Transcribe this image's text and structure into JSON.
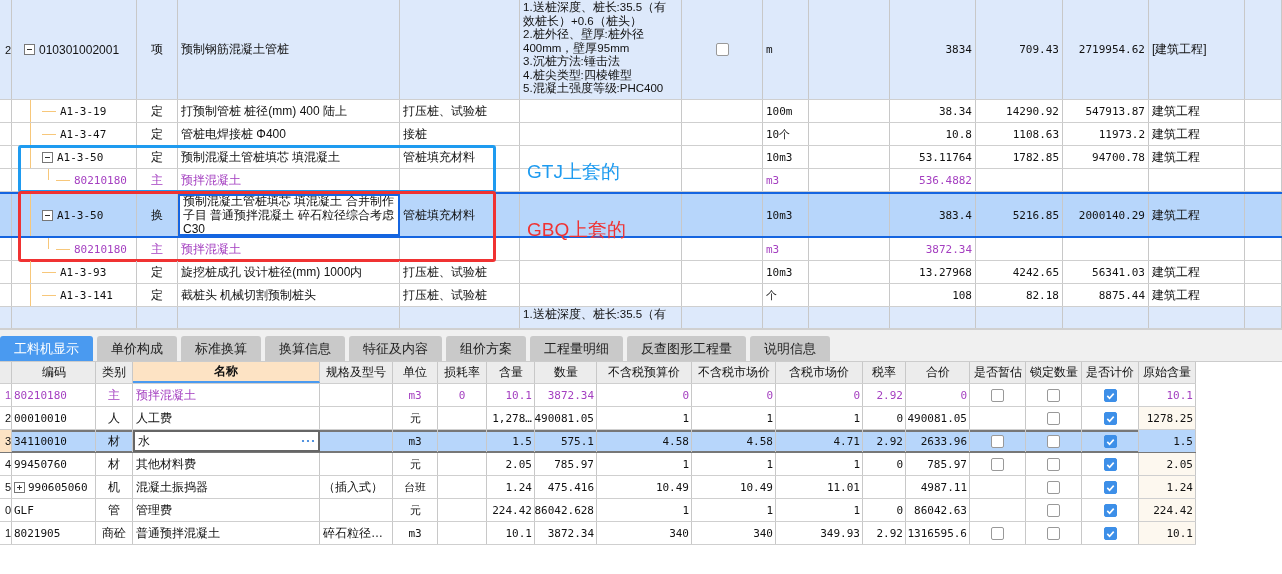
{
  "top_table": {
    "items": [
      {
        "row_no": "2",
        "code": "010301002001",
        "type": "项",
        "name": "预制钢筋混凝土管桩",
        "description": "1.送桩深度、桩长:35.5（有效桩长）+0.6（桩头）\n2.桩外径、壁厚:桩外径400mm，壁厚95mm\n3.沉桩方法:锤击法\n4.桩尖类型:四棱锥型\n5.混凝土强度等级:PHC400",
        "checked": false,
        "unit": "m",
        "quantity": "3834",
        "price": "709.43",
        "total": "2719954.62",
        "specialty": "[建筑工程]",
        "expanded": true,
        "children": [
          {
            "code": "A1-3-19",
            "type": "定",
            "name": "打预制管桩 桩径(mm) 400 陆上",
            "feature": "打压桩、试验桩",
            "unit": "100m",
            "quantity": "38.34",
            "price": "14290.92",
            "total": "547913.87",
            "specialty": "建筑工程",
            "selected": false
          },
          {
            "code": "A1-3-47",
            "type": "定",
            "name": "管桩电焊接桩 Φ400",
            "feature": "接桩",
            "unit": "10个",
            "quantity": "10.8",
            "price": "1108.63",
            "total": "11973.2",
            "specialty": "建筑工程",
            "selected": false
          },
          {
            "code": "A1-3-50",
            "type": "定",
            "name": "预制混凝土管桩填芯 填混凝土",
            "feature": "管桩填充材料",
            "unit": "10m3",
            "quantity": "53.11764",
            "price": "1782.85",
            "total": "94700.78",
            "specialty": "建筑工程",
            "selected": false,
            "expanded": true,
            "annotation": {
              "text": "GTJ上套的",
              "color": "#1e9bf0"
            },
            "children": [
              {
                "code": "80210180",
                "type": "主",
                "name": "预拌混凝土",
                "unit": "m3",
                "quantity": "536.4882"
              }
            ]
          },
          {
            "code": "A1-3-50",
            "type": "换",
            "name": "预制混凝土管桩填芯 填混凝土  合并制作子目 普通预拌混凝土 碎石粒径综合考虑 C30",
            "feature": "管桩填充材料",
            "unit": "10m3",
            "quantity": "383.4",
            "price": "5216.85",
            "total": "2000140.29",
            "specialty": "建筑工程",
            "selected": true,
            "expanded": true,
            "annotation": {
              "text": "GBQ上套的",
              "color": "#f03232"
            },
            "children": [
              {
                "code": "80210180",
                "type": "主",
                "name": "预拌混凝土",
                "unit": "m3",
                "quantity": "3872.34"
              }
            ]
          },
          {
            "code": "A1-3-93",
            "type": "定",
            "name": "旋挖桩成孔 设计桩径(mm) 1000内",
            "feature": "打压桩、试验桩",
            "unit": "10m3",
            "quantity": "13.27968",
            "price": "4242.65",
            "total": "56341.03",
            "specialty": "建筑工程",
            "selected": false
          },
          {
            "code": "A1-3-141",
            "type": "定",
            "name": "截桩头 机械切割预制桩头",
            "feature": "打压桩、试验桩",
            "unit": "个",
            "quantity": "108",
            "price": "82.18",
            "total": "8875.44",
            "specialty": "建筑工程",
            "selected": false
          }
        ]
      },
      {
        "description": "1.送桩深度、桩长:35.5（有"
      }
    ]
  },
  "tabs": [
    {
      "label": "工料机显示",
      "selected": true
    },
    {
      "label": "单价构成",
      "selected": false
    },
    {
      "label": "标准换算",
      "selected": false
    },
    {
      "label": "换算信息",
      "selected": false
    },
    {
      "label": "特征及内容",
      "selected": false
    },
    {
      "label": "组价方案",
      "selected": false
    },
    {
      "label": "工程量明细",
      "selected": false
    },
    {
      "label": "反查图形工程量",
      "selected": false
    },
    {
      "label": "说明信息",
      "selected": false
    }
  ],
  "resource_table": {
    "columns": [
      "编码",
      "类别",
      "名称",
      "规格及型号",
      "单位",
      "损耗率",
      "含量",
      "数量",
      "不含税预算价",
      "不含税市场价",
      "含税市场价",
      "税率",
      "合价",
      "是否暂估",
      "锁定数量",
      "是否计价",
      "原始含量"
    ],
    "rows": [
      {
        "row_no": "1",
        "kind": "main",
        "code": "80210180",
        "category": "主",
        "name": "预拌混凝土",
        "unit": "m3",
        "loss": "0",
        "content": "10.1",
        "quantity": "3872.34",
        "budget_price": "0",
        "market_price": "0",
        "tax_market_price": "0",
        "tax_rate": "2.92",
        "total": "0",
        "provisional": false,
        "locked": false,
        "priced": true,
        "original_content": "10.1",
        "selected": false
      },
      {
        "row_no": "2",
        "kind": "normal",
        "code": "00010010",
        "category": "人",
        "name": "人工费",
        "unit": "元",
        "content": "1,278…",
        "quantity": "490081.05",
        "budget_price": "1",
        "market_price": "1",
        "tax_market_price": "1",
        "tax_rate": "0",
        "total": "490081.05",
        "locked": false,
        "priced": true,
        "original_content": "1278.25",
        "selected": false
      },
      {
        "row_no": "3",
        "kind": "normal",
        "code": "34110010",
        "category": "材",
        "name": "水",
        "unit": "m3",
        "content": "1.5",
        "quantity": "575.1",
        "budget_price": "4.58",
        "market_price": "4.58",
        "tax_market_price": "4.71",
        "tax_rate": "2.92",
        "total": "2633.96",
        "provisional": false,
        "locked": false,
        "priced": true,
        "original_content": "1.5",
        "selected": true
      },
      {
        "row_no": "4",
        "kind": "normal",
        "code": "99450760",
        "category": "材",
        "name": "其他材料费",
        "unit": "元",
        "content": "2.05",
        "quantity": "785.97",
        "budget_price": "1",
        "market_price": "1",
        "tax_market_price": "1",
        "tax_rate": "0",
        "total": "785.97",
        "provisional": false,
        "locked": false,
        "priced": true,
        "original_content": "2.05",
        "selected": false
      },
      {
        "row_no": "5",
        "kind": "normal",
        "code": "990605060",
        "expanded": false,
        "category": "机",
        "name": "混凝土振捣器",
        "spec": "（插入式）",
        "unit": "台班",
        "content": "1.24",
        "quantity": "475.416",
        "budget_price": "10.49",
        "market_price": "10.49",
        "tax_market_price": "11.01",
        "total": "4987.11",
        "locked": false,
        "priced": true,
        "original_content": "1.24",
        "selected": false
      },
      {
        "row_no": "0",
        "kind": "normal",
        "code": "GLF",
        "category": "管",
        "name": "管理费",
        "unit": "元",
        "content": "224.42",
        "quantity": "86042.628",
        "budget_price": "1",
        "market_price": "1",
        "tax_market_price": "1",
        "tax_rate": "0",
        "total": "86042.63",
        "locked": false,
        "priced": true,
        "original_content": "224.42",
        "selected": false
      },
      {
        "row_no": "1",
        "kind": "normal",
        "code": "8021905",
        "category": "商砼",
        "name": "普通预拌混凝土",
        "spec": "碎石粒径…",
        "unit": "m3",
        "content": "10.1",
        "quantity": "3872.34",
        "budget_price": "340",
        "market_price": "340",
        "tax_market_price": "349.93",
        "tax_rate": "2.92",
        "total": "1316595.6",
        "provisional": false,
        "locked": false,
        "priced": true,
        "original_content": "10.1",
        "selected": false
      }
    ]
  }
}
